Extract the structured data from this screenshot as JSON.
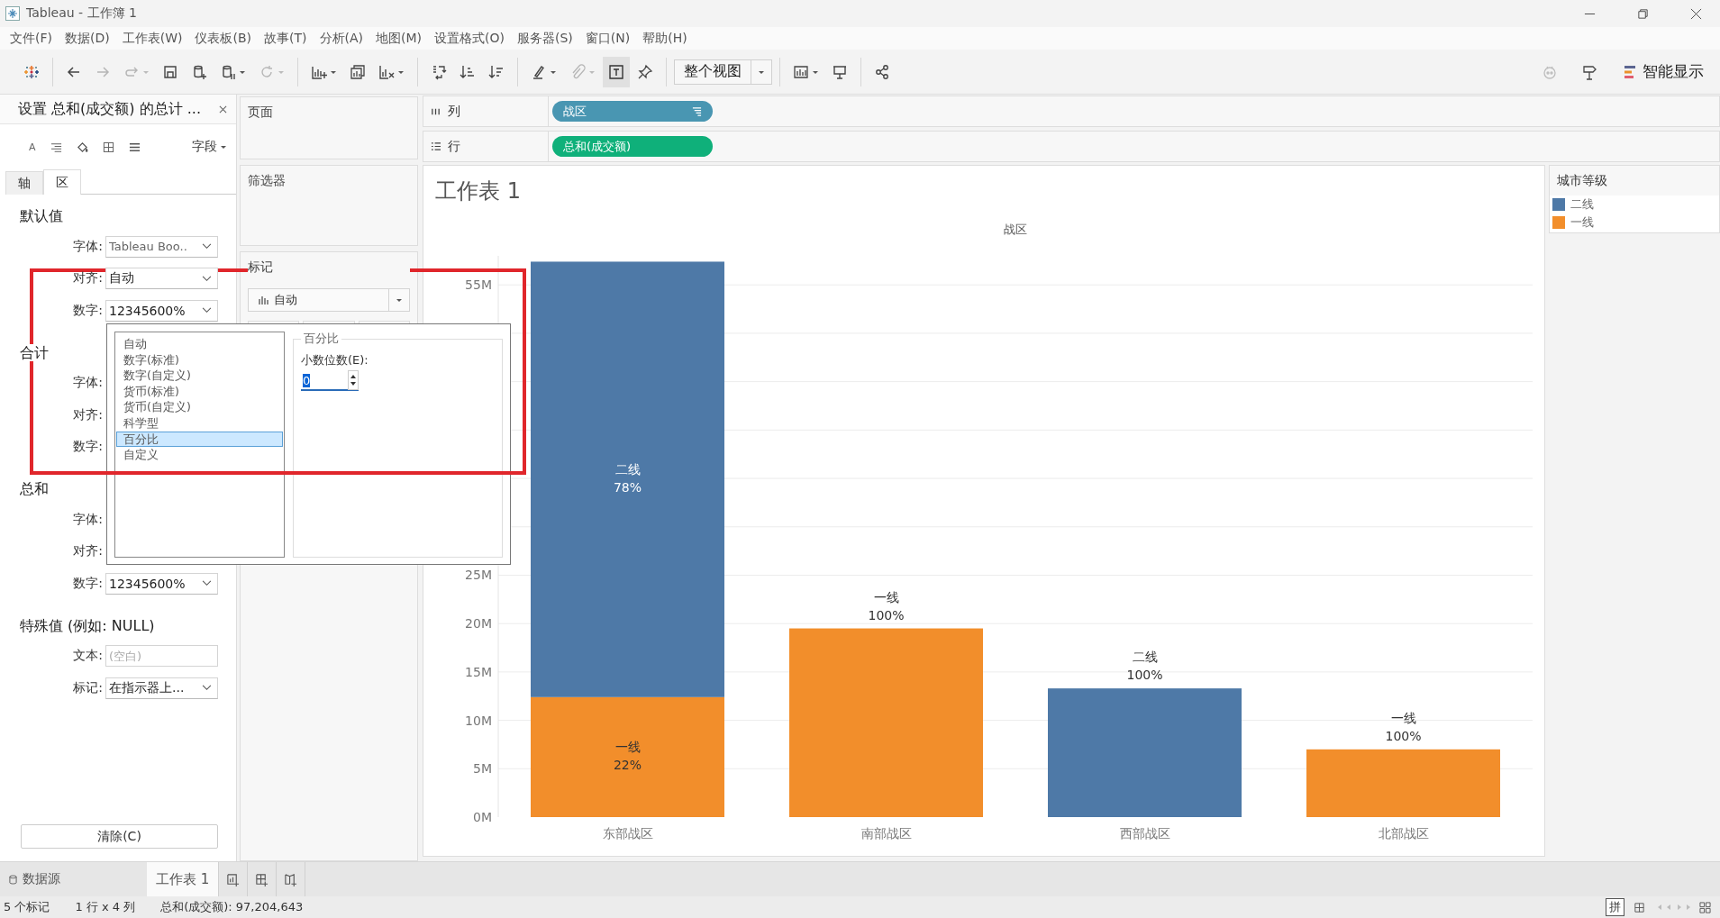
{
  "window": {
    "title": "Tableau - 工作簿 1"
  },
  "menu": [
    "文件(F)",
    "数据(D)",
    "工作表(W)",
    "仪表板(B)",
    "故事(T)",
    "分析(A)",
    "地图(M)",
    "设置格式(O)",
    "服务器(S)",
    "窗口(N)",
    "帮助(H)"
  ],
  "toolbar": {
    "groups": [
      [
        {
          "kind": "icon",
          "disabled": false,
          "dropdown": false,
          "pressed": false
        }
      ],
      [
        {
          "kind": "icon",
          "disabled": false,
          "dropdown": false,
          "pressed": false
        },
        {
          "kind": "icon",
          "disabled": true,
          "dropdown": false,
          "pressed": false
        },
        {
          "kind": "icon",
          "disabled": true,
          "dropdown": true,
          "pressed": false
        },
        {
          "kind": "icon",
          "disabled": false,
          "dropdown": false,
          "pressed": false
        },
        {
          "kind": "icon",
          "disabled": false,
          "dropdown": false,
          "pressed": false
        },
        {
          "kind": "icon",
          "disabled": false,
          "dropdown": true,
          "pressed": false
        },
        {
          "kind": "icon",
          "disabled": true,
          "dropdown": true,
          "pressed": false
        }
      ],
      [
        {
          "kind": "icon",
          "disabled": false,
          "dropdown": true,
          "pressed": false
        },
        {
          "kind": "icon",
          "disabled": false,
          "dropdown": false,
          "pressed": false
        },
        {
          "kind": "icon",
          "disabled": false,
          "dropdown": true,
          "pressed": false
        }
      ],
      [
        {
          "kind": "icon",
          "disabled": false,
          "dropdown": false,
          "pressed": false
        },
        {
          "kind": "icon",
          "disabled": false,
          "dropdown": false,
          "pressed": false
        },
        {
          "kind": "icon",
          "disabled": false,
          "dropdown": false,
          "pressed": false
        }
      ],
      [
        {
          "kind": "icon",
          "disabled": false,
          "dropdown": true,
          "pressed": false
        },
        {
          "kind": "icon",
          "disabled": true,
          "dropdown": true,
          "pressed": false
        },
        {
          "kind": "icon",
          "disabled": false,
          "dropdown": false,
          "pressed": true
        },
        {
          "kind": "icon",
          "disabled": false,
          "dropdown": false,
          "pressed": false
        }
      ],
      [
        {
          "kind": "select",
          "value": "整个视图"
        }
      ],
      [
        {
          "kind": "icon",
          "disabled": false,
          "dropdown": true,
          "pressed": false
        },
        {
          "kind": "icon",
          "disabled": false,
          "dropdown": false,
          "pressed": false
        }
      ],
      [
        {
          "kind": "icon",
          "disabled": false,
          "dropdown": false,
          "pressed": false
        }
      ]
    ],
    "show_me": "智能显示"
  },
  "format_pane": {
    "title": "设置 总和(成交额) 的总计 ...",
    "font_glyph": "A",
    "field_menu": "字段",
    "tabs": [
      {
        "label": "轴",
        "selected": false
      },
      {
        "label": "区",
        "selected": true
      }
    ],
    "sections": [
      {
        "heading": "默认值",
        "rows": [
          {
            "label": "字体:",
            "kind": "font",
            "value": "Tableau Boo.."
          },
          {
            "label": "对齐:",
            "kind": "dropdown",
            "value": "自动"
          },
          {
            "label": "数字:",
            "kind": "dropdown",
            "value": "12345600%"
          }
        ]
      },
      {
        "heading": "合计",
        "rows": [
          {
            "label": "字体:",
            "kind": "covered"
          },
          {
            "label": "对齐:",
            "kind": "covered"
          },
          {
            "label": "数字:",
            "kind": "covered"
          }
        ]
      },
      {
        "heading": "总和",
        "rows": [
          {
            "label": "字体:",
            "kind": "covered"
          },
          {
            "label": "对齐:",
            "kind": "covered"
          },
          {
            "label": "数字:",
            "kind": "dropdown",
            "value": "12345600%"
          }
        ]
      },
      {
        "heading": "特殊值 (例如: NULL)",
        "rows": [
          {
            "label": "文本:",
            "kind": "text",
            "placeholder": "(空白)"
          },
          {
            "label": "标记:",
            "kind": "dropdown",
            "value": "在指示器上..."
          }
        ]
      }
    ],
    "clear_button": "清除(C)"
  },
  "cards": {
    "pages": "页面",
    "filters": "筛选器",
    "marks": {
      "title": "标记",
      "mark_type": "自动"
    }
  },
  "columns_shelf": {
    "label": "列",
    "pill": {
      "text": "战区",
      "kind": "discrete"
    }
  },
  "rows_shelf": {
    "label": "行",
    "pill": {
      "text": "总和(成交额)",
      "kind": "continuous"
    }
  },
  "view": {
    "title": "工作表 1",
    "chart_data": {
      "type": "bar",
      "stacked": true,
      "grid": true,
      "title": "战区",
      "categories": [
        "东部战区",
        "南部战区",
        "西部战区",
        "北部战区"
      ],
      "series": [
        {
          "name": "一线",
          "color": "#f28e2b",
          "values": [
            12.4,
            19.5,
            null,
            7.0
          ]
        },
        {
          "name": "二线",
          "color": "#4e79a7",
          "values": [
            45.0,
            null,
            13.3,
            null
          ]
        }
      ],
      "ylim": [
        0,
        58
      ],
      "yticks": [
        {
          "value": 0,
          "label": "0M"
        },
        {
          "value": 5,
          "label": "5M"
        },
        {
          "value": 10,
          "label": "10M"
        },
        {
          "value": 15,
          "label": "15M"
        },
        {
          "value": 20,
          "label": "20M"
        },
        {
          "value": 25,
          "label": "25M"
        },
        {
          "value": 55,
          "label": "55M"
        }
      ],
      "value_labels": [
        [
          "22%",
          "100%",
          null,
          "100%"
        ],
        [
          "78%",
          null,
          "100%",
          null
        ]
      ]
    }
  },
  "legend": {
    "title": "城市等级",
    "items": [
      {
        "label": "二线",
        "color": "#4e79a7"
      },
      {
        "label": "一线",
        "color": "#f28e2b"
      }
    ]
  },
  "format_popup": {
    "list": [
      {
        "label": "自动",
        "selected": false
      },
      {
        "label": "数字(标准)",
        "selected": false
      },
      {
        "label": "数字(自定义)",
        "selected": false
      },
      {
        "label": "货币(标准)",
        "selected": false
      },
      {
        "label": "货币(自定义)",
        "selected": false
      },
      {
        "label": "科学型",
        "selected": false
      },
      {
        "label": "百分比",
        "selected": true
      },
      {
        "label": "自定义",
        "selected": false
      }
    ],
    "group_title": "百分比",
    "decimals_label": "小数位数(E):",
    "decimals_value": "0"
  },
  "bottom_tabs": {
    "data_source": "数据源",
    "sheets": [
      {
        "label": "工作表 1",
        "selected": true
      }
    ]
  },
  "status_bar": {
    "items": [
      "5 个标记",
      "1 行 x 4 列",
      "总和(成交额): 97,204,643"
    ],
    "ime": "拼"
  }
}
